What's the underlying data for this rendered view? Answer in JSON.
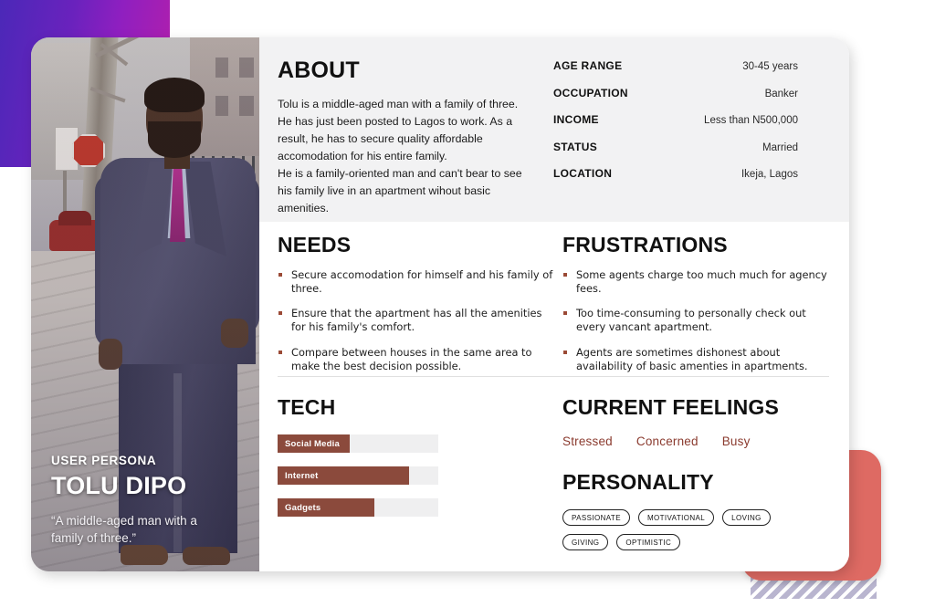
{
  "persona": {
    "kicker": "USER PERSONA",
    "name": "TOLU DIPO",
    "quote": "“A middle-aged man with a family of three.”"
  },
  "about": {
    "title": "ABOUT",
    "body": "Tolu is a middle-aged man with a family of three. He has just been posted to Lagos to work. As a result, he has to secure quality affordable accomodation for his entire family.\nHe is a family-oriented man and can't bear to see his family live in an apartment wihout basic amenities.",
    "attributes": [
      {
        "label": "AGE RANGE",
        "value": "30-45 years"
      },
      {
        "label": "OCCUPATION",
        "value": "Banker"
      },
      {
        "label": "INCOME",
        "value": "Less than N500,000"
      },
      {
        "label": "STATUS",
        "value": "Married"
      },
      {
        "label": "LOCATION",
        "value": "Ikeja, Lagos"
      }
    ]
  },
  "needs": {
    "title": "NEEDS",
    "items": [
      "Secure accomodation for himself and his family of three.",
      "Ensure that the apartment has all the amenities for his family's comfort.",
      "Compare between houses in the same area to make the best decision possible."
    ]
  },
  "frustrations": {
    "title": "FRUSTRATIONS",
    "items": [
      "Some agents charge too much much for agency fees.",
      "Too time-consuming to personally check out every vancant apartment.",
      "Agents are sometimes dishonest about availability of basic amenties in apartments."
    ]
  },
  "tech": {
    "title": "TECH",
    "bars": [
      {
        "label": "Social Media",
        "percent": 45
      },
      {
        "label": "Internet",
        "percent": 82
      },
      {
        "label": "Gadgets",
        "percent": 60
      }
    ]
  },
  "feelings": {
    "title": "CURRENT FEELINGS",
    "items": [
      "Stressed",
      "Concerned",
      "Busy"
    ]
  },
  "personality": {
    "title": "PERSONALITY",
    "traits": [
      "PASSIONATE",
      "MOTIVATIONAL",
      "LOVING",
      "GIVING",
      "OPTIMISTIC"
    ]
  },
  "colors": {
    "accent_brown": "#8b4a3c",
    "feeling_text": "#8a3a2e",
    "coral": "#de6a63",
    "stripes": "#b9b5cf",
    "panel_bg": "#f2f2f3"
  }
}
